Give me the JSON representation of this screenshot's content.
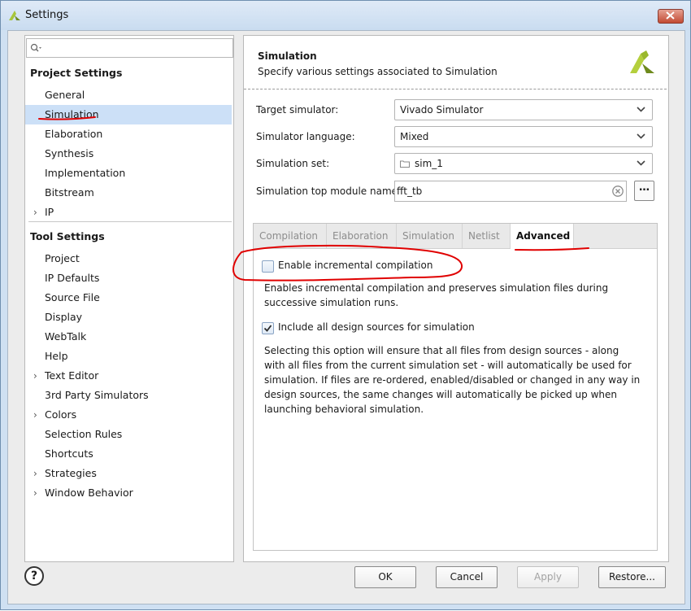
{
  "window": {
    "title": "Settings"
  },
  "search": {
    "placeholder": ""
  },
  "sidebar": {
    "project_heading": "Project Settings",
    "project_items": [
      {
        "label": "General",
        "expandable": false,
        "selected": false
      },
      {
        "label": "Simulation",
        "expandable": false,
        "selected": true
      },
      {
        "label": "Elaboration",
        "expandable": false,
        "selected": false
      },
      {
        "label": "Synthesis",
        "expandable": false,
        "selected": false
      },
      {
        "label": "Implementation",
        "expandable": false,
        "selected": false
      },
      {
        "label": "Bitstream",
        "expandable": false,
        "selected": false
      },
      {
        "label": "IP",
        "expandable": true,
        "selected": false
      }
    ],
    "tool_heading": "Tool Settings",
    "tool_items": [
      {
        "label": "Project",
        "expandable": false
      },
      {
        "label": "IP Defaults",
        "expandable": false
      },
      {
        "label": "Source File",
        "expandable": false
      },
      {
        "label": "Display",
        "expandable": false
      },
      {
        "label": "WebTalk",
        "expandable": false
      },
      {
        "label": "Help",
        "expandable": false
      },
      {
        "label": "Text Editor",
        "expandable": true
      },
      {
        "label": "3rd Party Simulators",
        "expandable": false
      },
      {
        "label": "Colors",
        "expandable": true
      },
      {
        "label": "Selection Rules",
        "expandable": false
      },
      {
        "label": "Shortcuts",
        "expandable": false
      },
      {
        "label": "Strategies",
        "expandable": true
      },
      {
        "label": "Window Behavior",
        "expandable": true
      }
    ]
  },
  "header": {
    "title": "Simulation",
    "subtitle": "Specify various settings associated to Simulation"
  },
  "form": {
    "target_label": "Target simulator:",
    "target_value": "Vivado Simulator",
    "language_label": "Simulator language:",
    "language_value": "Mixed",
    "simset_label": "Simulation set:",
    "simset_value": "sim_1",
    "top_label": "Simulation top module name:",
    "top_value": "fft_tb",
    "browse_label": "…"
  },
  "tabs": [
    {
      "label": "Compilation",
      "active": false
    },
    {
      "label": "Elaboration",
      "active": false
    },
    {
      "label": "Simulation",
      "active": false
    },
    {
      "label": "Netlist",
      "active": false
    },
    {
      "label": "Advanced",
      "active": true
    }
  ],
  "advanced": {
    "incremental_label": "Enable incremental compilation",
    "incremental_checked": false,
    "incremental_desc": "Enables incremental compilation and preserves simulation files during successive simulation runs.",
    "include_label": "Include all design sources for simulation",
    "include_checked": true,
    "include_desc": "Selecting this option will ensure that all files from design sources - along with all files from the current simulation set - will automatically be used for simulation. If files are re-ordered, enabled/disabled or changed in any way in design sources, the same changes will automatically be picked up when launching behavioral simulation."
  },
  "footer": {
    "help_label": "?",
    "ok_label": "OK",
    "cancel_label": "Cancel",
    "apply_label": "Apply",
    "restore_label": "Restore..."
  },
  "colors": {
    "selection": "#cce0f7",
    "annotation_ink": "#e00000",
    "logo_green": "#8aa52a"
  }
}
